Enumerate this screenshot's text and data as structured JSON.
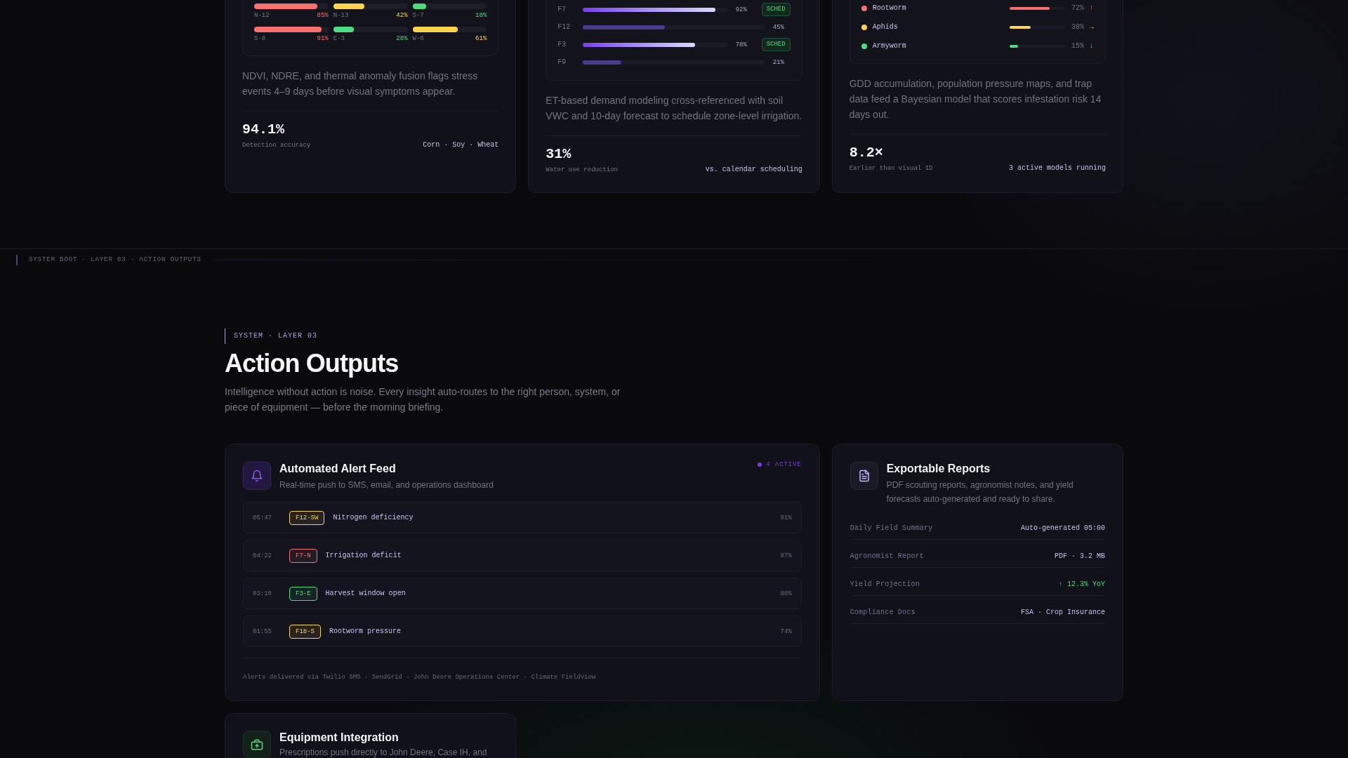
{
  "top_cards": [
    {
      "kind": "zones",
      "zones": [
        {
          "label": "N-12",
          "reading": "85%",
          "level": 0.85,
          "color": "#f87171"
        },
        {
          "label": "N-13",
          "reading": "42%",
          "level": 0.42,
          "color": "#fcd34d"
        },
        {
          "label": "S-7",
          "reading": "18%",
          "level": 0.18,
          "color": "#4ade80"
        },
        {
          "label": "S-8",
          "reading": "91%",
          "level": 0.91,
          "color": "#f87171"
        },
        {
          "label": "E-3",
          "reading": "28%",
          "level": 0.28,
          "color": "#4ade80"
        },
        {
          "label": "W-6",
          "reading": "61%",
          "level": 0.61,
          "color": "#fcd34d"
        }
      ],
      "description": "NDVI, NDRE, and thermal anomaly fusion flags stress events 4–9 days before visual symptoms appear.",
      "stat": "94.1%",
      "stat_label": "Detection accuracy",
      "note": "Corn · Soy · Wheat"
    },
    {
      "kind": "irrigation",
      "fields": [
        {
          "label": "F7",
          "level": 0.92,
          "reading": "92%",
          "scheduled": true,
          "badge": "SCHED"
        },
        {
          "label": "F12",
          "level": 0.45,
          "reading": "45%",
          "scheduled": false
        },
        {
          "label": "F3",
          "level": 0.78,
          "reading": "78%",
          "scheduled": true,
          "badge": "SCHED"
        },
        {
          "label": "F9",
          "level": 0.21,
          "reading": "21%",
          "scheduled": false
        }
      ],
      "description": "ET-based demand modeling cross-referenced with soil VWC and 10-day forecast to schedule zone-level irrigation.",
      "stat": "31%",
      "stat_label": "Water use reduction",
      "note": "vs. calendar scheduling"
    },
    {
      "kind": "pests",
      "pests": [
        {
          "name": "Rootworm",
          "color": "#f87171",
          "level": 0.72,
          "reading": "72%",
          "trend": "↑"
        },
        {
          "name": "Aphids",
          "color": "#fcd34d",
          "level": 0.38,
          "reading": "38%",
          "trend": "→"
        },
        {
          "name": "Armyworm",
          "color": "#4ade80",
          "level": 0.15,
          "reading": "15%",
          "trend": "↓"
        }
      ],
      "description": "GDD accumulation, population pressure maps, and trap data feed a Bayesian model that scores infestation risk 14 days out.",
      "stat": "8.2×",
      "stat_label": "Earlier than visual ID",
      "note": "3 active models running"
    }
  ],
  "breadcrumb": "SYSTEM BOOT · LAYER 03 · ACTION OUTPUTS",
  "section": {
    "eyebrow": "SYSTEM · LAYER 03",
    "title": "Action Outputs",
    "intro": "Intelligence without action is noise. Every insight auto-routes to the right person, system, or piece of equipment — before the morning briefing."
  },
  "output_cards": [
    {
      "kind": "alert_feed",
      "title": "Automated Alert Feed",
      "subtitle": "Real-time push to SMS, email, and operations dashboard",
      "status": "4 ACTIVE",
      "alerts": [
        {
          "time": "05:47",
          "tag": "F12-SW",
          "color": "#fcd34d",
          "message": "Nitrogen deficiency",
          "confidence": "91%"
        },
        {
          "time": "04:22",
          "tag": "F7-N",
          "color": "#f87171",
          "message": "Irrigation deficit",
          "confidence": "97%"
        },
        {
          "time": "03:10",
          "tag": "F3-E",
          "color": "#4ade80",
          "message": "Harvest window open",
          "confidence": "88%"
        },
        {
          "time": "01:55",
          "tag": "F18-S",
          "color": "#fcd34d",
          "message": "Rootworm pressure",
          "confidence": "74%"
        }
      ],
      "footnote": "Alerts delivered via Twilio SMS · SendGrid · John Deere Operations Center · Climate FieldView"
    },
    {
      "kind": "reports",
      "title": "Exportable Reports",
      "subtitle": "PDF scouting reports, agronomist notes, and yield forecasts auto-generated and ready to share.",
      "rows": [
        {
          "label": "Daily Field Summary",
          "value": "Auto-generated 05:00",
          "positive": false
        },
        {
          "label": "Agronomist Report",
          "value": "PDF · 3.2 MB",
          "positive": false
        },
        {
          "label": "Yield Projection",
          "value": "↑ 12.3% YoY",
          "positive": true
        },
        {
          "label": "Compliance Docs",
          "value": "FSA · Crop Insurance",
          "positive": false
        }
      ]
    },
    {
      "kind": "equipment",
      "title": "Equipment Integration",
      "subtitle": "Prescriptions push directly to John Deere, Case IH, and"
    }
  ]
}
